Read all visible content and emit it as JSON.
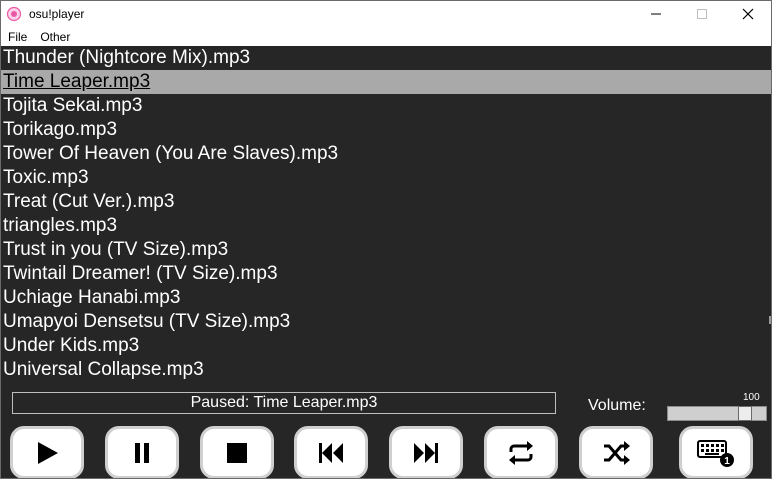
{
  "window": {
    "title": "osu!player"
  },
  "menu": [
    {
      "label": "File"
    },
    {
      "label": "Other"
    }
  ],
  "songs": [
    {
      "label": "Thunder (Nightcore Mix).mp3"
    },
    {
      "label": "Time Leaper.mp3",
      "selected": true
    },
    {
      "label": "Tojita Sekai.mp3"
    },
    {
      "label": "Torikago.mp3"
    },
    {
      "label": "Tower Of Heaven (You Are Slaves).mp3"
    },
    {
      "label": "Toxic.mp3"
    },
    {
      "label": "Treat (Cut Ver.).mp3"
    },
    {
      "label": "triangles.mp3"
    },
    {
      "label": "Trust in you (TV Size).mp3"
    },
    {
      "label": "Twintail Dreamer! (TV Size).mp3"
    },
    {
      "label": "Uchiage Hanabi.mp3"
    },
    {
      "label": "Umapyoi Densetsu (TV Size).mp3"
    },
    {
      "label": "Under Kids.mp3"
    },
    {
      "label": "Universal Collapse.mp3"
    }
  ],
  "status": {
    "text": "Paused: Time Leaper.mp3"
  },
  "volume": {
    "label": "Volume:",
    "value": "100",
    "level_percent": 100
  },
  "controls": [
    {
      "name": "play-button",
      "icon": "play-icon"
    },
    {
      "name": "pause-button",
      "icon": "pause-icon"
    },
    {
      "name": "stop-button",
      "icon": "stop-icon"
    },
    {
      "name": "previous-button",
      "icon": "skip-back-icon"
    },
    {
      "name": "next-button",
      "icon": "skip-forward-icon"
    },
    {
      "name": "repeat-button",
      "icon": "repeat-icon"
    },
    {
      "name": "shuffle-button",
      "icon": "shuffle-icon"
    },
    {
      "name": "keyboard-button",
      "icon": "keyboard-icon",
      "badge": "1"
    }
  ],
  "colors": {
    "background": "#262626",
    "selected_row": "#a9a9a9",
    "text": "#ffffff"
  }
}
